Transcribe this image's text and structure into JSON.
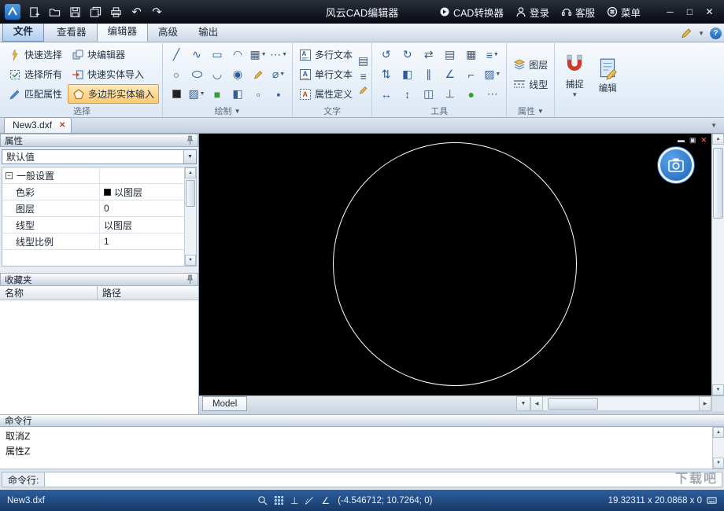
{
  "colors": {
    "titlebar_bg": "#0a0d14",
    "ribbon_bg": "#e9f1fa",
    "highlight_orange": "#ffc96e",
    "canvas_bg": "#000000",
    "circle_stroke": "#ffffff",
    "statusbar_bg": "#1d4678",
    "accent_blue": "#2f7cd0"
  },
  "titlebar": {
    "title": "风云CAD编辑器",
    "icons": [
      "app-logo",
      "new-file",
      "open-folder",
      "save",
      "save-as",
      "print",
      "undo",
      "redo"
    ],
    "menu": [
      {
        "label": "CAD转换器",
        "icon": "cad-converter-icon"
      },
      {
        "label": "登录",
        "icon": "login-icon"
      },
      {
        "label": "客服",
        "icon": "support-icon"
      },
      {
        "label": "菜单",
        "icon": "menu-icon"
      }
    ]
  },
  "tabs": [
    "文件",
    "查看器",
    "编辑器",
    "高级",
    "输出"
  ],
  "ribbon": {
    "selection": {
      "label": "选择",
      "items": [
        "快速选择",
        "块编辑器",
        "选择所有",
        "快速实体导入",
        "匹配属性",
        "多边形实体输入"
      ],
      "icons": [
        "quick-select-icon",
        "block-editor-icon",
        "select-all-icon",
        "quick-entity-import-icon",
        "match-properties-icon",
        "polygon-entity-input-icon"
      ]
    },
    "draw": {
      "label": "绘制",
      "icons": [
        "line-icon",
        "spline-icon",
        "rectangle-icon",
        "arc-icon",
        "array-icon",
        "points-icon",
        "circle-icon",
        "ellipse-icon",
        "arc-bottom-icon",
        "donut-icon",
        "sketch-icon",
        "diameter-icon",
        "color-icon",
        "hatch-icon",
        "region-icon",
        "gradient-icon"
      ]
    },
    "text": {
      "label": "文字",
      "items": [
        "多行文本",
        "单行文本",
        "属性定义"
      ],
      "icons": [
        "multiline-text-icon",
        "singleline-text-icon",
        "attribute-define-icon",
        "table-icon",
        "edit-text-icon"
      ]
    },
    "tools": {
      "label": "工具",
      "icons": [
        "rotate-ccw-icon",
        "rotate-cw-icon",
        "swap-icon",
        "measure-icon",
        "grid-icon",
        "list-icon",
        "updown-icon",
        "mirror-icon",
        "parallel-icon",
        "angle-icon",
        "corner-icon",
        "hatch-edit-icon",
        "move-h-icon",
        "move-v-icon",
        "align-icon",
        "perpendicular-icon",
        "more-icon",
        "point-style-icon"
      ]
    },
    "props": {
      "label": "属性",
      "layer": "图层",
      "linetype": "线型",
      "snap": "捕捉",
      "edit": "编辑"
    }
  },
  "doc_tab": {
    "label": "New3.dxf"
  },
  "panel": {
    "properties": {
      "title": "属性",
      "combo_value": "默认值",
      "group": "一般设置",
      "rows": [
        {
          "name": "色彩",
          "value": "以图层"
        },
        {
          "name": "图层",
          "value": "0"
        },
        {
          "name": "线型",
          "value": "以图层"
        },
        {
          "name": "线型比例",
          "value": "1"
        }
      ]
    },
    "favorites": {
      "title": "收藏夹",
      "col_name": "名称",
      "col_path": "路径"
    }
  },
  "canvas": {
    "model_tab": "Model"
  },
  "cmd": {
    "title": "命令行",
    "history": [
      "取消Z",
      "属性Z"
    ],
    "prompt": "命令行:"
  },
  "status": {
    "file": "New3.dxf",
    "coords": "(-4.546712; 10.7264; 0)",
    "dims": "19.32311 x 20.0868 x 0"
  },
  "watermark": "下载吧"
}
